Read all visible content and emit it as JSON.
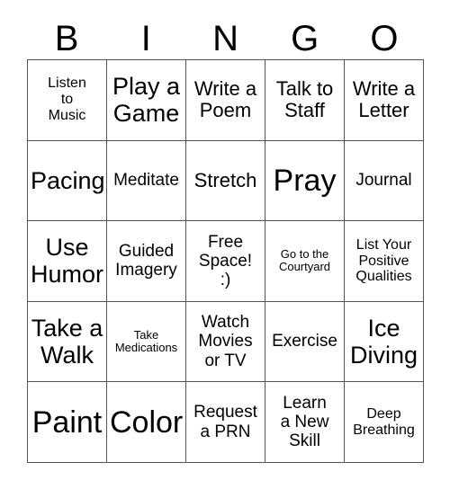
{
  "card": {
    "header_letters": [
      "B",
      "I",
      "N",
      "G",
      "O"
    ],
    "rows": [
      [
        {
          "text": "Listen\nto\nMusic",
          "size": "sm"
        },
        {
          "text": "Play a\nGame",
          "size": "xl"
        },
        {
          "text": "Write a\nPoem",
          "size": "lg"
        },
        {
          "text": "Talk to\nStaff",
          "size": "lg"
        },
        {
          "text": "Write a\nLetter",
          "size": "lg"
        }
      ],
      [
        {
          "text": "Pacing",
          "size": "xl"
        },
        {
          "text": "Meditate",
          "size": "md"
        },
        {
          "text": "Stretch",
          "size": "lg"
        },
        {
          "text": "Pray",
          "size": "xxl"
        },
        {
          "text": "Journal",
          "size": "md"
        }
      ],
      [
        {
          "text": "Use\nHumor",
          "size": "xl"
        },
        {
          "text": "Guided\nImagery",
          "size": "md"
        },
        {
          "text": "Free\nSpace!\n:)",
          "size": "md"
        },
        {
          "text": "Go to the\nCourtyard",
          "size": "xs"
        },
        {
          "text": "List Your\nPositive\nQualities",
          "size": "sm"
        }
      ],
      [
        {
          "text": "Take a\nWalk",
          "size": "xl"
        },
        {
          "text": "Take\nMedications",
          "size": "xs"
        },
        {
          "text": "Watch\nMovies\nor TV",
          "size": "md"
        },
        {
          "text": "Exercise",
          "size": "md"
        },
        {
          "text": "Ice\nDiving",
          "size": "xl"
        }
      ],
      [
        {
          "text": "Paint",
          "size": "xxl"
        },
        {
          "text": "Color",
          "size": "xxl"
        },
        {
          "text": "Request\na PRN",
          "size": "md"
        },
        {
          "text": "Learn\na New\nSkill",
          "size": "md"
        },
        {
          "text": "Deep\nBreathing",
          "size": "sm"
        }
      ]
    ]
  }
}
